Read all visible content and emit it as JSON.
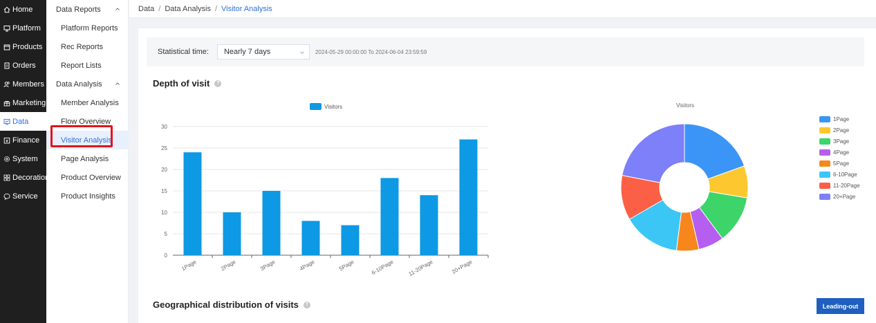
{
  "nav": {
    "items": [
      {
        "label": "Home",
        "icon": "home-icon"
      },
      {
        "label": "Platform",
        "icon": "monitor-icon"
      },
      {
        "label": "Products",
        "icon": "box-icon"
      },
      {
        "label": "Orders",
        "icon": "document-icon"
      },
      {
        "label": "Members",
        "icon": "users-icon"
      },
      {
        "label": "Marketing",
        "icon": "gift-icon"
      },
      {
        "label": "Data",
        "icon": "chart-icon",
        "active": true
      },
      {
        "label": "Finance",
        "icon": "wallet-icon"
      },
      {
        "label": "System",
        "icon": "gear-icon"
      },
      {
        "label": "Decoration",
        "icon": "palette-icon"
      },
      {
        "label": "Service",
        "icon": "chat-icon"
      }
    ]
  },
  "submenu": {
    "group1": "Data Reports",
    "group1_items": [
      "Platform Reports",
      "Rec Reports",
      "Report Lists"
    ],
    "group2": "Data Analysis",
    "group2_items": [
      "Member Analysis",
      "Flow Overview",
      "Visitor Analysis",
      "Page Analysis",
      "Product Overview",
      "Product Insights"
    ],
    "active": "Visitor Analysis"
  },
  "breadcrumb": {
    "items": [
      "Data",
      "Data Analysis",
      "Visitor Analysis"
    ],
    "sep": "/"
  },
  "filter": {
    "label": "Statistical time:",
    "selected": "Nearly 7 days",
    "range": "2024-05-29 00:00:00 To 2024-06-04 23:59:59"
  },
  "sections": {
    "depth_title": "Depth of visit",
    "geo_title": "Geographical distribution of visits",
    "help_glyph": "?"
  },
  "export_button": "Leading-out",
  "colors": {
    "accent": "#2f6fd9",
    "bar": "#0d99e3",
    "button": "#1e5fc0",
    "highlight": "#e0161b"
  },
  "chart_data": [
    {
      "type": "bar",
      "categories": [
        "1Page",
        "2Page",
        "3Page",
        "4Page",
        "5Page",
        "6-10Page",
        "11-20Page",
        "20+Page"
      ],
      "series": [
        {
          "name": "Visitors",
          "values": [
            24,
            10,
            15,
            8,
            7,
            18,
            14,
            27
          ]
        }
      ],
      "ylim": [
        0,
        30
      ],
      "yticks": [
        0,
        5,
        10,
        15,
        20,
        25,
        30
      ],
      "grid": true,
      "legend": "top-center"
    },
    {
      "type": "pie",
      "title": "Visitors",
      "labels": [
        "1Page",
        "2Page",
        "3Page",
        "4Page",
        "5Page",
        "6-10Page",
        "11-20Page",
        "20+Page"
      ],
      "values": [
        24,
        10,
        15,
        8,
        7,
        18,
        14,
        27
      ],
      "colors": [
        "#3a95f6",
        "#fdc82f",
        "#3dd46a",
        "#b65ef0",
        "#f7871c",
        "#3cc6f6",
        "#fb6046",
        "#7d80f8"
      ],
      "legend": "right"
    }
  ]
}
